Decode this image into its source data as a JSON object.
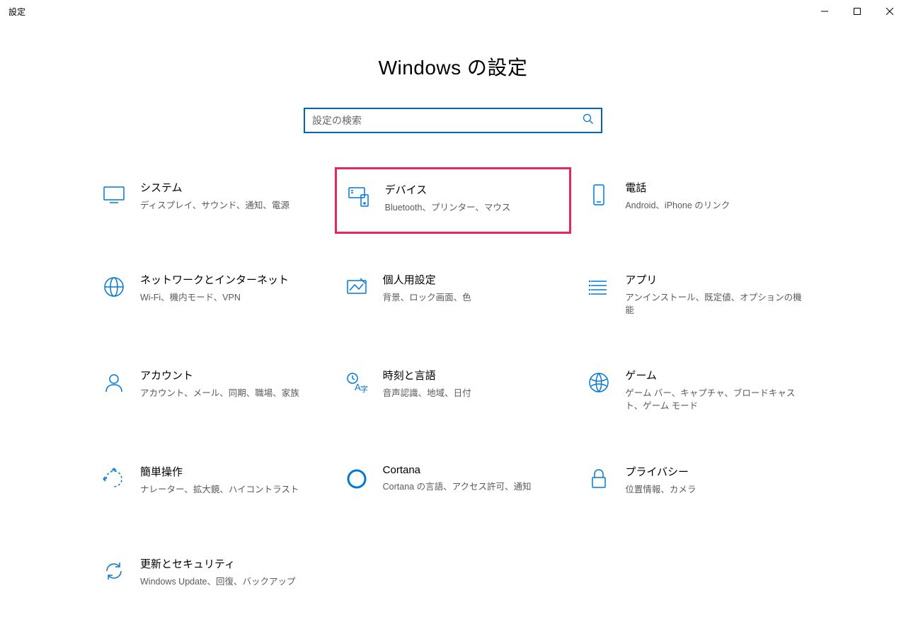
{
  "window": {
    "title": "設定"
  },
  "header": {
    "title": "Windows の設定"
  },
  "search": {
    "placeholder": "設定の検索"
  },
  "tiles": [
    {
      "id": "system",
      "title": "システム",
      "desc": "ディスプレイ、サウンド、通知、電源",
      "highlight": false
    },
    {
      "id": "devices",
      "title": "デバイス",
      "desc": "Bluetooth、プリンター、マウス",
      "highlight": true
    },
    {
      "id": "phone",
      "title": "電話",
      "desc": "Android、iPhone のリンク",
      "highlight": false
    },
    {
      "id": "network",
      "title": "ネットワークとインターネット",
      "desc": "Wi-Fi、機内モード、VPN",
      "highlight": false
    },
    {
      "id": "personalize",
      "title": "個人用設定",
      "desc": "背景、ロック画面、色",
      "highlight": false
    },
    {
      "id": "apps",
      "title": "アプリ",
      "desc": "アンインストール、既定値、オプションの機能",
      "highlight": false
    },
    {
      "id": "accounts",
      "title": "アカウント",
      "desc": "アカウント、メール、同期、職場、家族",
      "highlight": false
    },
    {
      "id": "time",
      "title": "時刻と言語",
      "desc": "音声認識、地域、日付",
      "highlight": false
    },
    {
      "id": "gaming",
      "title": "ゲーム",
      "desc": "ゲーム バー、キャプチャ、ブロードキャスト、ゲーム モード",
      "highlight": false
    },
    {
      "id": "ease",
      "title": "簡単操作",
      "desc": "ナレーター、拡大鏡、ハイコントラスト",
      "highlight": false
    },
    {
      "id": "cortana",
      "title": "Cortana",
      "desc": "Cortana の言語、アクセス許可、通知",
      "highlight": false
    },
    {
      "id": "privacy",
      "title": "プライバシー",
      "desc": "位置情報、カメラ",
      "highlight": false
    },
    {
      "id": "update",
      "title": "更新とセキュリティ",
      "desc": "Windows Update、回復、バックアップ",
      "highlight": false
    }
  ],
  "highlight_color": "#e6265e",
  "accent_color": "#0078d7"
}
